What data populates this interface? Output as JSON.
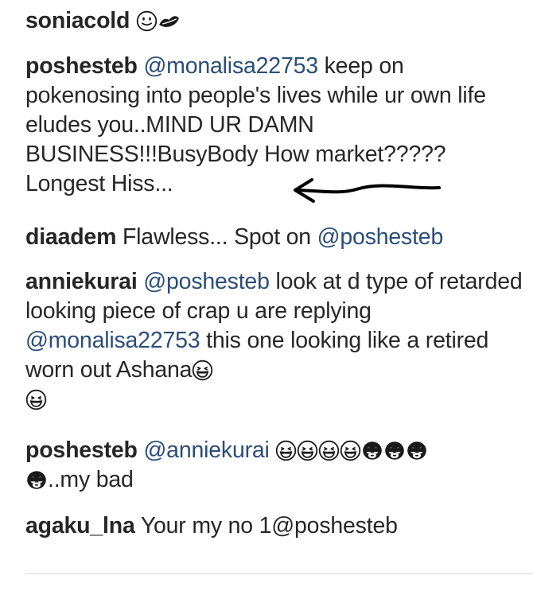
{
  "comments": [
    {
      "username": "soniacold",
      "emoji": [
        "slightly-smiling-face-icon",
        "kiss-mark-icon"
      ]
    },
    {
      "username": "poshesteb",
      "mention": "@monalisa22753",
      "text": " keep on pokenosing into people's lives while ur own life eludes you..MIND UR DAMN BUSINESS!!!BusyBody How market????? Longest Hiss..."
    },
    {
      "username": "diaadem",
      "text": " Flawless... Spot on ",
      "mention": "@poshesteb"
    },
    {
      "username": "anniekurai",
      "mention": "@poshesteb",
      "text": " look at d type of retarded looking piece of crap u are replying ",
      "mention2": "@monalisa22753",
      "text2": " this one looking like a retired worn out Ashana",
      "emoji": [
        "grinning-squinting-face-icon",
        "grinning-squinting-face-icon"
      ]
    },
    {
      "username": "poshesteb",
      "mention": "@anniekurai",
      "emoji": [
        "grinning-squinting-face-icon",
        "grinning-squinting-face-icon",
        "grinning-squinting-face-icon",
        "grinning-squinting-face-icon",
        "see-no-evil-monkey-icon",
        "see-no-evil-monkey-icon",
        "see-no-evil-monkey-icon",
        "see-no-evil-monkey-icon"
      ],
      "text": "..my bad"
    },
    {
      "username": "agaku_lna",
      "text": " Your my no 1@poshesteb"
    }
  ],
  "annotation": {
    "icon": "hand-drawn-arrow-icon",
    "color": "#000000"
  },
  "colors": {
    "username": "#262626",
    "text": "#262626",
    "mention": "#2b4d79",
    "divider": "#dcdcdc"
  }
}
